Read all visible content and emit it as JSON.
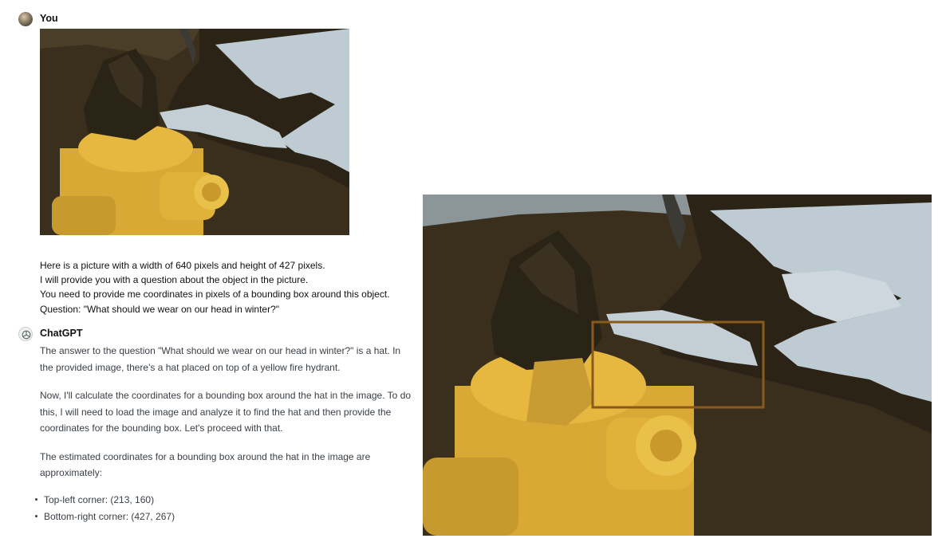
{
  "user": {
    "name": "You",
    "prompt_lines": [
      "Here is a picture with a width of 640 pixels and height of 427 pixels.",
      "I will provide you with a question about the object in the picture.",
      "You need to provide me coordinates in pixels of a bounding box around this object.",
      "Question: \"What should we wear on our head in winter?\""
    ]
  },
  "assistant": {
    "name": "ChatGPT",
    "paragraphs": [
      "The answer to the question \"What should we wear on our head in winter?\" is a hat. In the provided image, there's a hat placed on top of a yellow fire hydrant.",
      "Now, I'll calculate the coordinates for a bounding box around the hat in the image. To do this, I will need to load the image and analyze it to find the hat and then provide the coordinates for the bounding box. Let's proceed with that.",
      "The estimated coordinates for a bounding box around the hat in the image are approximately:"
    ],
    "bullets": [
      "Top-left corner: (213, 160)",
      "Bottom-right corner: (427, 267)"
    ]
  },
  "icons": {
    "user_avatar": "user-avatar-photo",
    "assistant_avatar": "openai-logo-icon"
  },
  "colors": {
    "hydrant_yellow": "#e0b33c",
    "hat_dark": "#2a2417",
    "snow": "#c5d0d6",
    "ground": "#3b3020",
    "bbox_stroke": "#8a5a1c"
  }
}
